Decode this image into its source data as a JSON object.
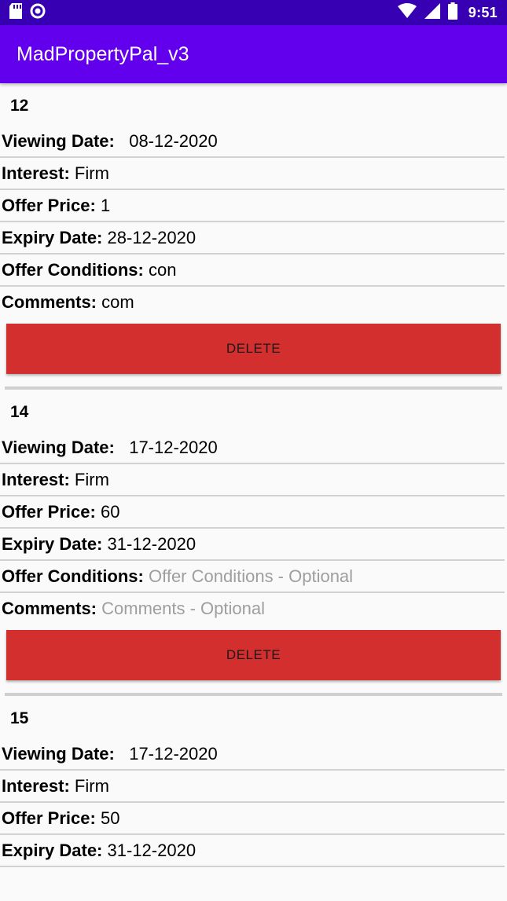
{
  "status_bar": {
    "time": "9:51",
    "icons_left": [
      "sd-card-icon",
      "notification-circle-icon"
    ],
    "icons_right": [
      "wifi-icon",
      "cell-signal-icon",
      "battery-icon"
    ]
  },
  "app_bar": {
    "title": "MadPropertyPal_v3"
  },
  "labels": {
    "viewing_date": "Viewing Date:",
    "interest": "Interest:",
    "offer_price": "Offer Price:",
    "expiry_date": "Expiry Date:",
    "offer_conditions": "Offer Conditions:",
    "comments": "Comments:",
    "delete": "DELETE"
  },
  "offers": [
    {
      "id": "12",
      "viewing_date": "08-12-2020",
      "interest": "Firm",
      "offer_price": "1",
      "expiry_date": "28-12-2020",
      "offer_conditions": "con",
      "comments": "com"
    },
    {
      "id": "14",
      "viewing_date": "17-12-2020",
      "interest": "Firm",
      "offer_price": "60",
      "expiry_date": "31-12-2020",
      "offer_conditions_placeholder": "Offer Conditions - Optional",
      "comments_placeholder": "Comments - Optional"
    },
    {
      "id": "15",
      "viewing_date": "17-12-2020",
      "interest": "Firm",
      "offer_price": "50",
      "expiry_date": "31-12-2020"
    }
  ],
  "colors": {
    "status_bar": "#3700b3",
    "app_bar": "#6200ee",
    "delete_button": "#d32f2f",
    "placeholder_text": "#9e9e9e"
  }
}
